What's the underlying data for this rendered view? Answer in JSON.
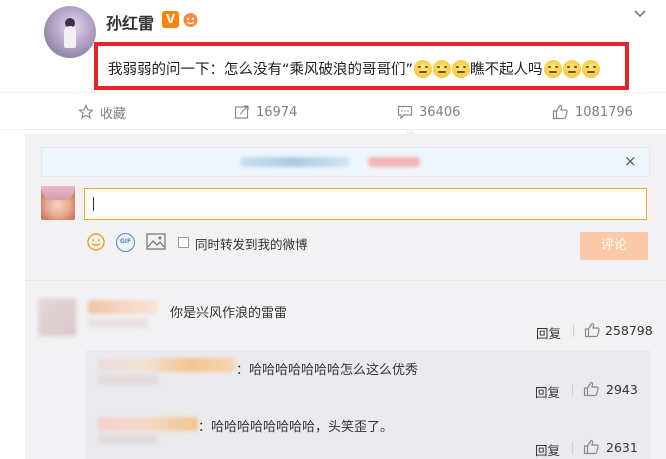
{
  "post": {
    "user_name": "孙红雷",
    "vip_badge": "V",
    "text": "我弱弱的问一下：怎么没有“乘风破浪的哥哥们”",
    "text_after": "瞧不起人吗"
  },
  "actions": {
    "favorite_label": "收藏",
    "forward_count": "16974",
    "comment_count": "36406",
    "like_count": "1081796"
  },
  "comment_box": {
    "input_value": "",
    "repost_label": "同时转发到我的微博",
    "submit_label": "评论",
    "close_glyph": "×",
    "gif_label": "GIF"
  },
  "comments": [
    {
      "text": "你是兴风作浪的雷雷",
      "reply_label": "回复",
      "likes": "258798"
    }
  ],
  "replies": [
    {
      "text": "：哈哈哈哈哈哈哈怎么这么优秀",
      "reply_label": "回复",
      "likes": "2943"
    },
    {
      "text": "：哈哈哈哈哈哈哈哈，头笑歪了。",
      "reply_label": "回复",
      "likes": "2631"
    }
  ],
  "colors": {
    "highlight_border": "#e3262a",
    "vip": "#ff8200",
    "input_focus": "#f5a623",
    "submit_disabled": "#fbc9a8"
  },
  "icons": {
    "favorite": "star-icon",
    "forward": "forward-icon",
    "comment": "comment-icon",
    "like": "thumbs-up-icon",
    "more": "chevron-down-icon",
    "emoji": "smiley-icon",
    "gif": "gif-icon",
    "image": "image-icon"
  }
}
